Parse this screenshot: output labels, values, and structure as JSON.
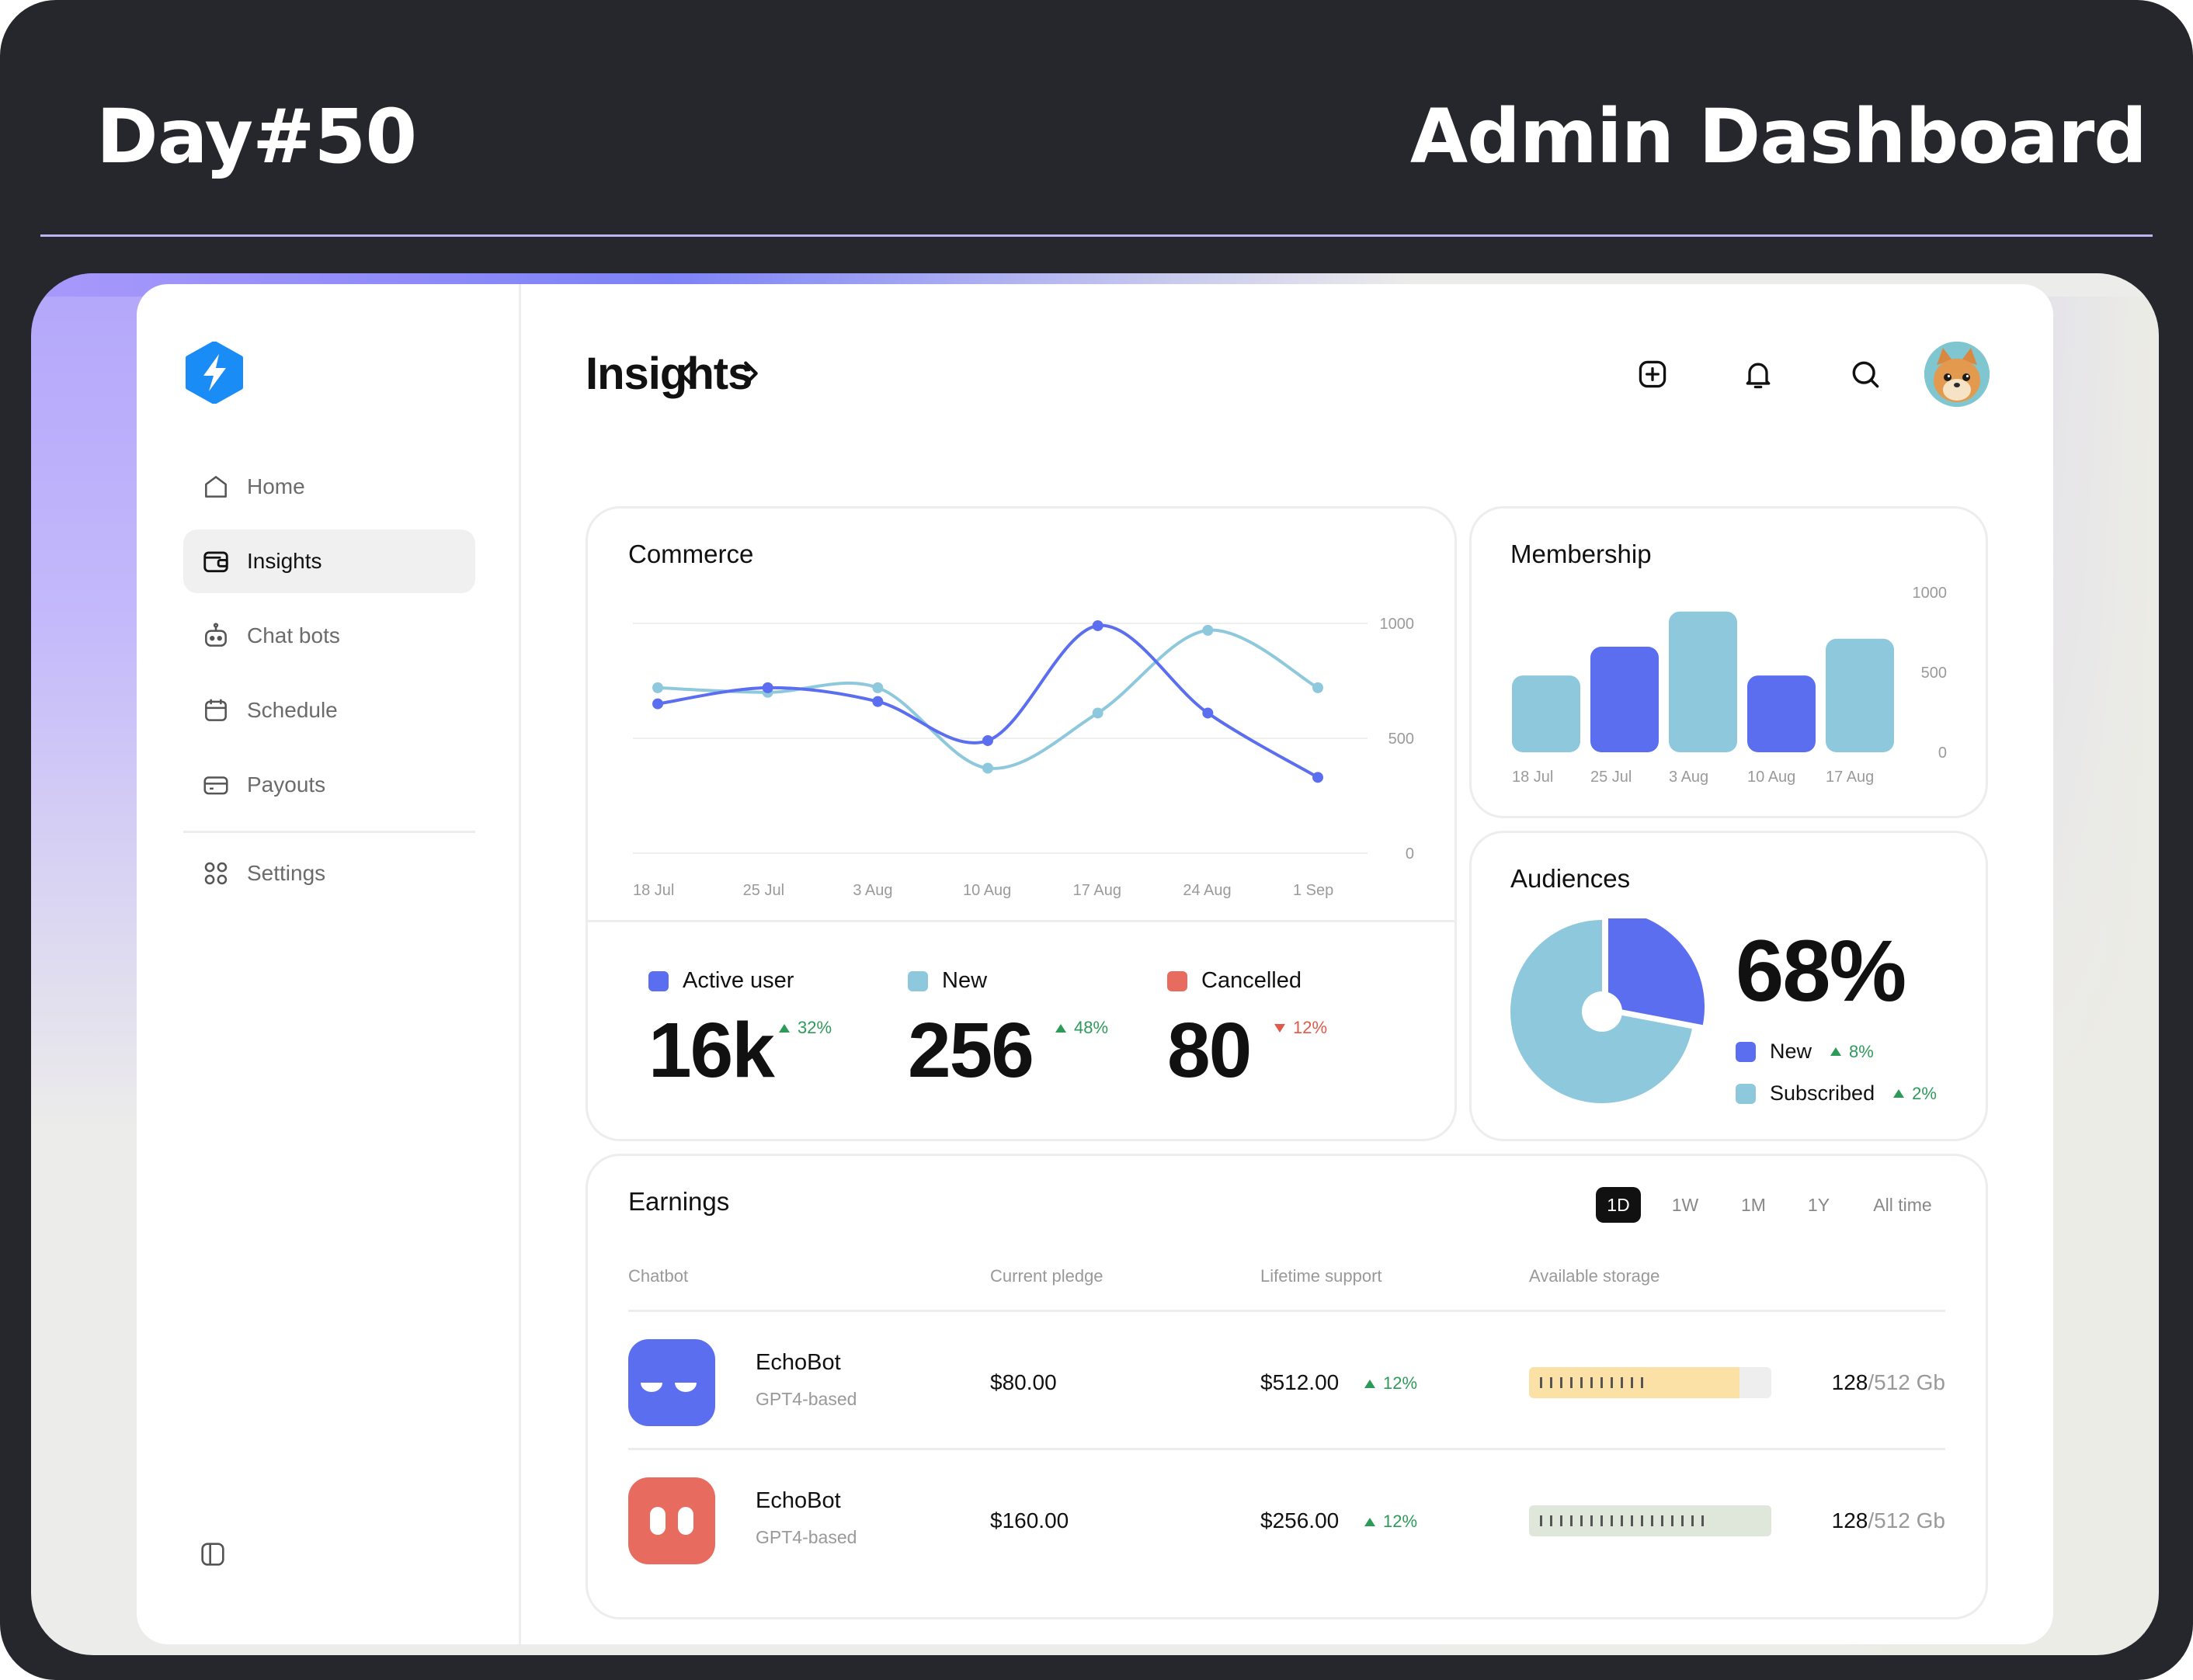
{
  "header": {
    "left": "Day#50",
    "right": "Admin Dashboard"
  },
  "sidebar": {
    "items": [
      {
        "label": "Home",
        "icon": "home-icon"
      },
      {
        "label": "Insights",
        "icon": "wallet-icon",
        "active": true
      },
      {
        "label": "Chat bots",
        "icon": "robot-icon"
      },
      {
        "label": "Schedule",
        "icon": "calendar-icon"
      },
      {
        "label": "Payouts",
        "icon": "card-icon"
      },
      {
        "label": "Settings",
        "icon": "grid-icon"
      }
    ]
  },
  "main": {
    "title": "Insights"
  },
  "commerce": {
    "title": "Commerce",
    "stats": [
      {
        "label": "Active user",
        "value": "16k",
        "delta": "32%",
        "trend": "up",
        "color": "#5b6ef0"
      },
      {
        "label": "New",
        "value": "256",
        "delta": "48%",
        "trend": "up",
        "color": "#8ec8dc"
      },
      {
        "label": "Cancelled",
        "value": "80",
        "delta": "12%",
        "trend": "down",
        "color": "#e86b5f"
      }
    ]
  },
  "membership": {
    "title": "Membership"
  },
  "audiences": {
    "title": "Audiences",
    "percent": "68%",
    "legend": [
      {
        "label": "New",
        "delta": "8%",
        "color": "#5b6ef0"
      },
      {
        "label": "Subscribed",
        "delta": "2%",
        "color": "#8ec8dc"
      }
    ]
  },
  "earnings": {
    "title": "Earnings",
    "periods": [
      "1D",
      "1W",
      "1M",
      "1Y",
      "All time"
    ],
    "active_period": "1D",
    "columns": [
      "Chatbot",
      "Current pledge",
      "Lifetime support",
      "Available storage"
    ],
    "rows": [
      {
        "name": "EchoBot",
        "sub": "GPT4-based",
        "pledge": "$80.00",
        "lifetime": "$512.00",
        "delta": "12%",
        "used": "128",
        "total": "/512 Gb",
        "icon_color": "#5b6ef0",
        "bar_color": "#fbe1a6",
        "bar_fill": 0.87,
        "ticks": 11
      },
      {
        "name": "EchoBot",
        "sub": "GPT4-based",
        "pledge": "$160.00",
        "lifetime": "$256.00",
        "delta": "12%",
        "used": "128",
        "total": "/512 Gb",
        "icon_color": "#e86b5f",
        "bar_color": "#dfe6da",
        "bar_fill": 1.0,
        "ticks": 17
      }
    ]
  },
  "chart_data": [
    {
      "type": "line",
      "title": "Commerce",
      "x": [
        "18 Jul",
        "25 Jul",
        "3 Aug",
        "10 Aug",
        "17 Aug",
        "24 Aug",
        "1 Sep"
      ],
      "yticks": [
        "1000",
        "500",
        "0"
      ],
      "ylim": [
        0,
        1000
      ],
      "series": [
        {
          "color": "#5b6ef0",
          "values": [
            650,
            720,
            660,
            490,
            990,
            610,
            330
          ]
        },
        {
          "color": "#8ec8dc",
          "values": [
            720,
            700,
            720,
            370,
            610,
            970,
            720
          ]
        }
      ],
      "grid": true
    },
    {
      "type": "bar",
      "title": "Membership",
      "categories": [
        "18 Jul",
        "25 Jul",
        "3 Aug",
        "10 Aug",
        "17 Aug"
      ],
      "values": [
        480,
        660,
        880,
        480,
        710
      ],
      "colors": [
        "#8ec8dc",
        "#5b6ef0",
        "#8ec8dc",
        "#5b6ef0",
        "#8ec8dc"
      ],
      "yticks": [
        "1000",
        "500",
        "0"
      ],
      "ylim": [
        0,
        1000
      ]
    },
    {
      "type": "pie",
      "title": "Audiences",
      "slices": [
        {
          "label": "New",
          "value": 28,
          "color": "#5b6ef0"
        },
        {
          "label": "Subscribed",
          "value": 72,
          "color": "#8ec8dc"
        }
      ]
    }
  ]
}
